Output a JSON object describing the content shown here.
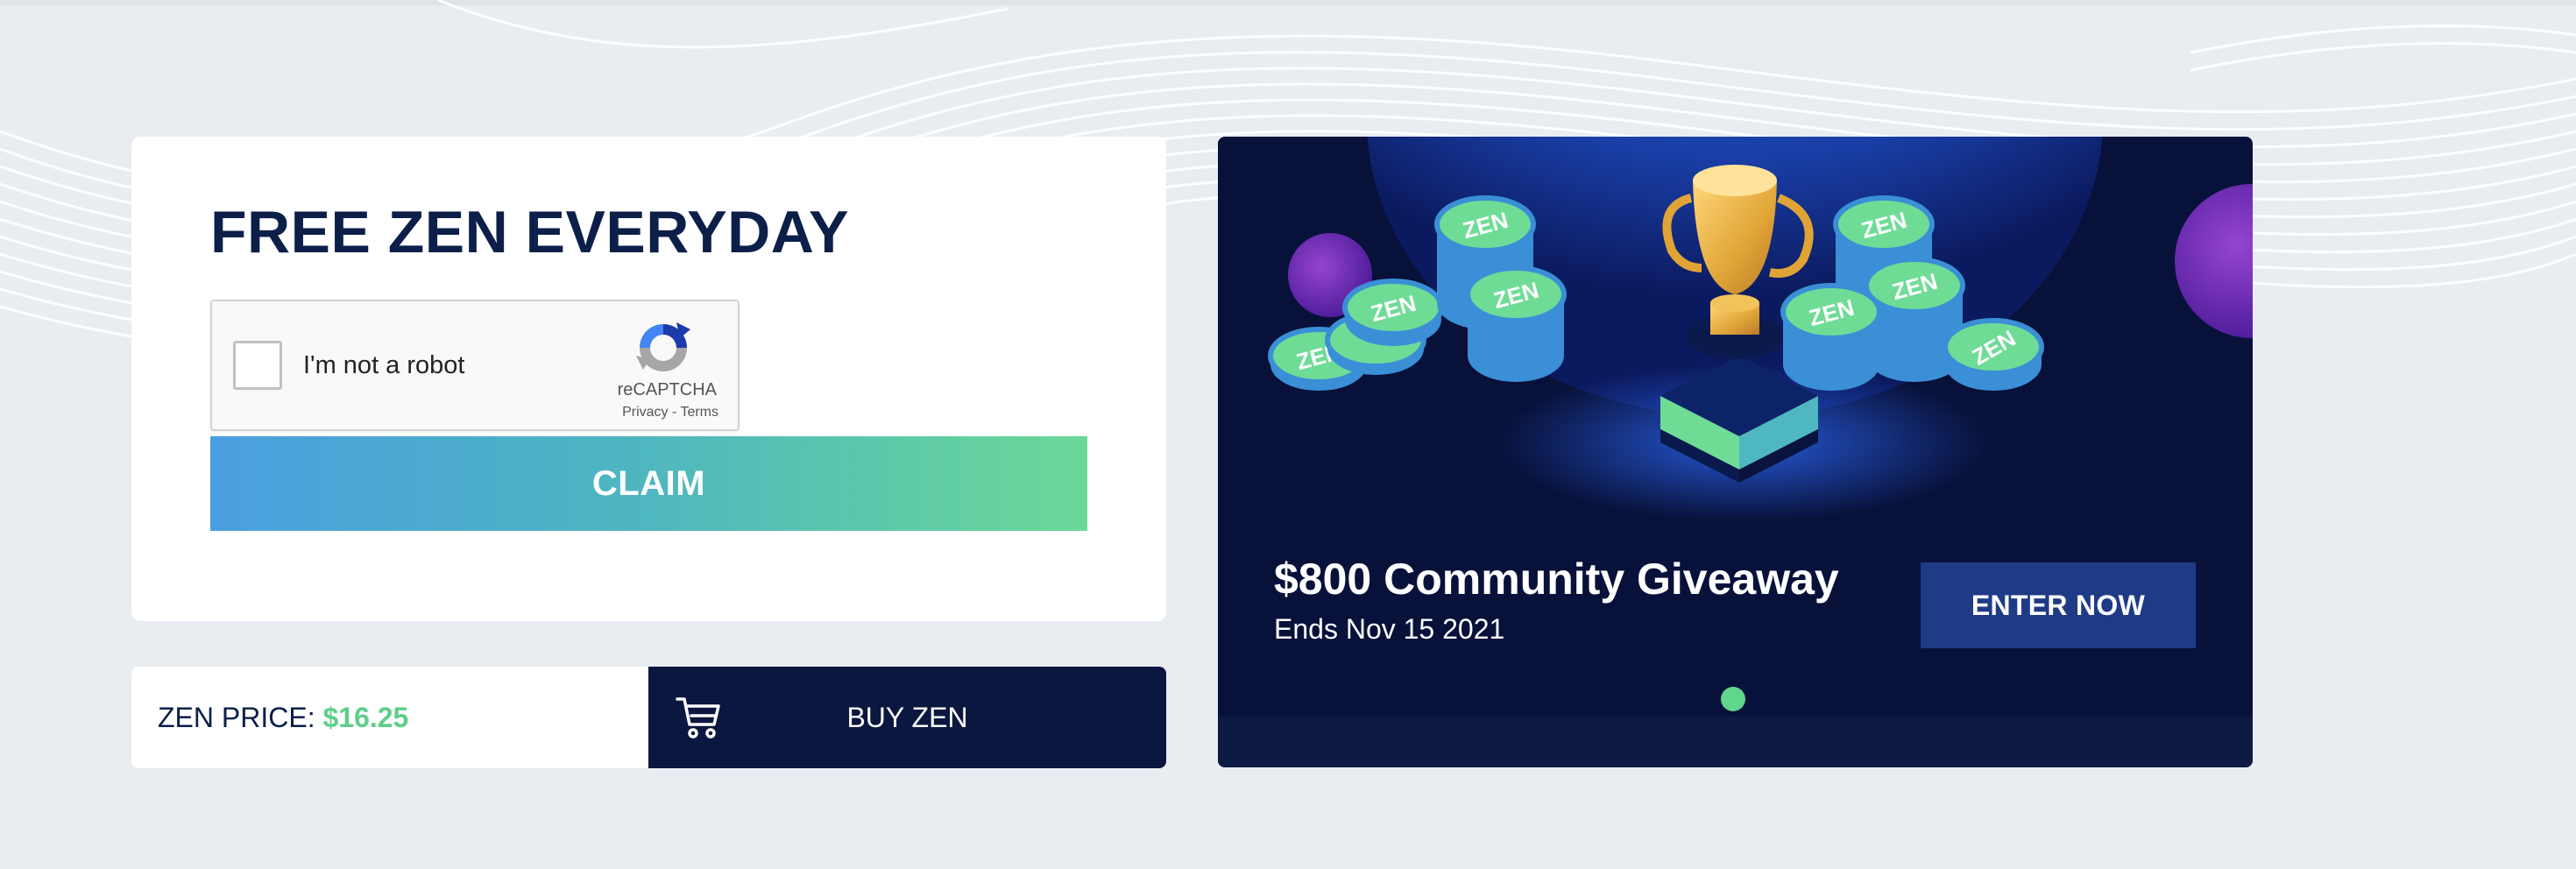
{
  "claim_card": {
    "title": "FREE ZEN EVERYDAY",
    "captcha": {
      "label": "I'm not a robot",
      "brand": "reCAPTCHA",
      "links": "Privacy - Terms"
    },
    "claim_button": "CLAIM"
  },
  "price_bar": {
    "label": "ZEN PRICE:",
    "value": "$16.25",
    "buy_button": "BUY ZEN",
    "buy_icon": "cart-icon"
  },
  "promo": {
    "title": "$800 Community Giveaway",
    "subtitle": "Ends Nov 15 2021",
    "enter_button": "ENTER NOW",
    "coin_text": "ZEN",
    "carousel_pages": 1,
    "carousel_active": 1
  },
  "colors": {
    "navy": "#0b1f49",
    "accent_green": "#5fce8a",
    "claim_gradient_start": "#4a9fe0",
    "claim_gradient_end": "#6bd897",
    "promo_bg": "#08113a",
    "enter_button_bg": "#1f3b86"
  }
}
